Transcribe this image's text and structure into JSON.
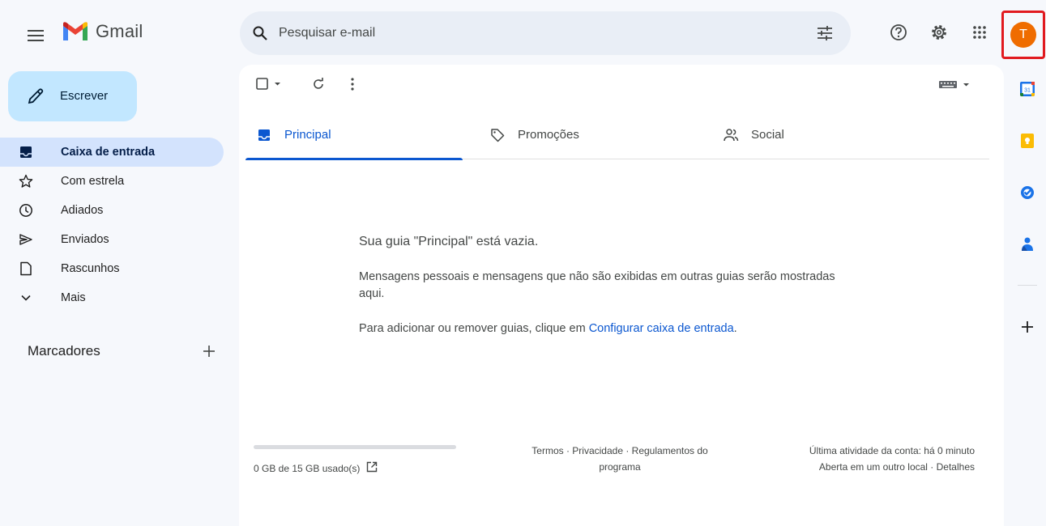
{
  "app": {
    "name": "Gmail"
  },
  "search": {
    "placeholder": "Pesquisar e-mail"
  },
  "account": {
    "initial": "T",
    "avatar_color": "#ef6c00"
  },
  "compose": {
    "label": "Escrever"
  },
  "nav": {
    "items": [
      {
        "label": "Caixa de entrada",
        "icon": "inbox-icon",
        "active": true
      },
      {
        "label": "Com estrela",
        "icon": "star-icon"
      },
      {
        "label": "Adiados",
        "icon": "clock-icon"
      },
      {
        "label": "Enviados",
        "icon": "send-icon"
      },
      {
        "label": "Rascunhos",
        "icon": "draft-icon"
      },
      {
        "label": "Mais",
        "icon": "chevron-down-icon"
      }
    ]
  },
  "labels": {
    "title": "Marcadores"
  },
  "tabs": [
    {
      "label": "Principal",
      "icon": "inbox-icon",
      "active": true
    },
    {
      "label": "Promoções",
      "icon": "tag-icon"
    },
    {
      "label": "Social",
      "icon": "people-icon"
    }
  ],
  "empty": {
    "title": "Sua guia \"Principal\" está vazia.",
    "description": "Mensagens pessoais e mensagens que não são exibidas em outras guias serão mostradas aqui.",
    "hint_prefix": "Para adicionar ou remover guias, clique em ",
    "hint_link": "Configurar caixa de entrada",
    "hint_suffix": "."
  },
  "footer": {
    "storage_text": "0 GB de 15 GB usado(s)",
    "storage_used_fraction": 0,
    "links_line1": "Termos · Privacidade · Regulamentos do",
    "links_line2": "programa",
    "activity_line1": "Última atividade da conta: há 0 minuto",
    "activity_line2": "Aberta em um outro local · Detalhes"
  },
  "colors": {
    "accent": "#0b57d0",
    "compose_bg": "#c2e7ff",
    "active_nav_bg": "#d3e3fd",
    "highlight_border": "#e11a1f"
  }
}
